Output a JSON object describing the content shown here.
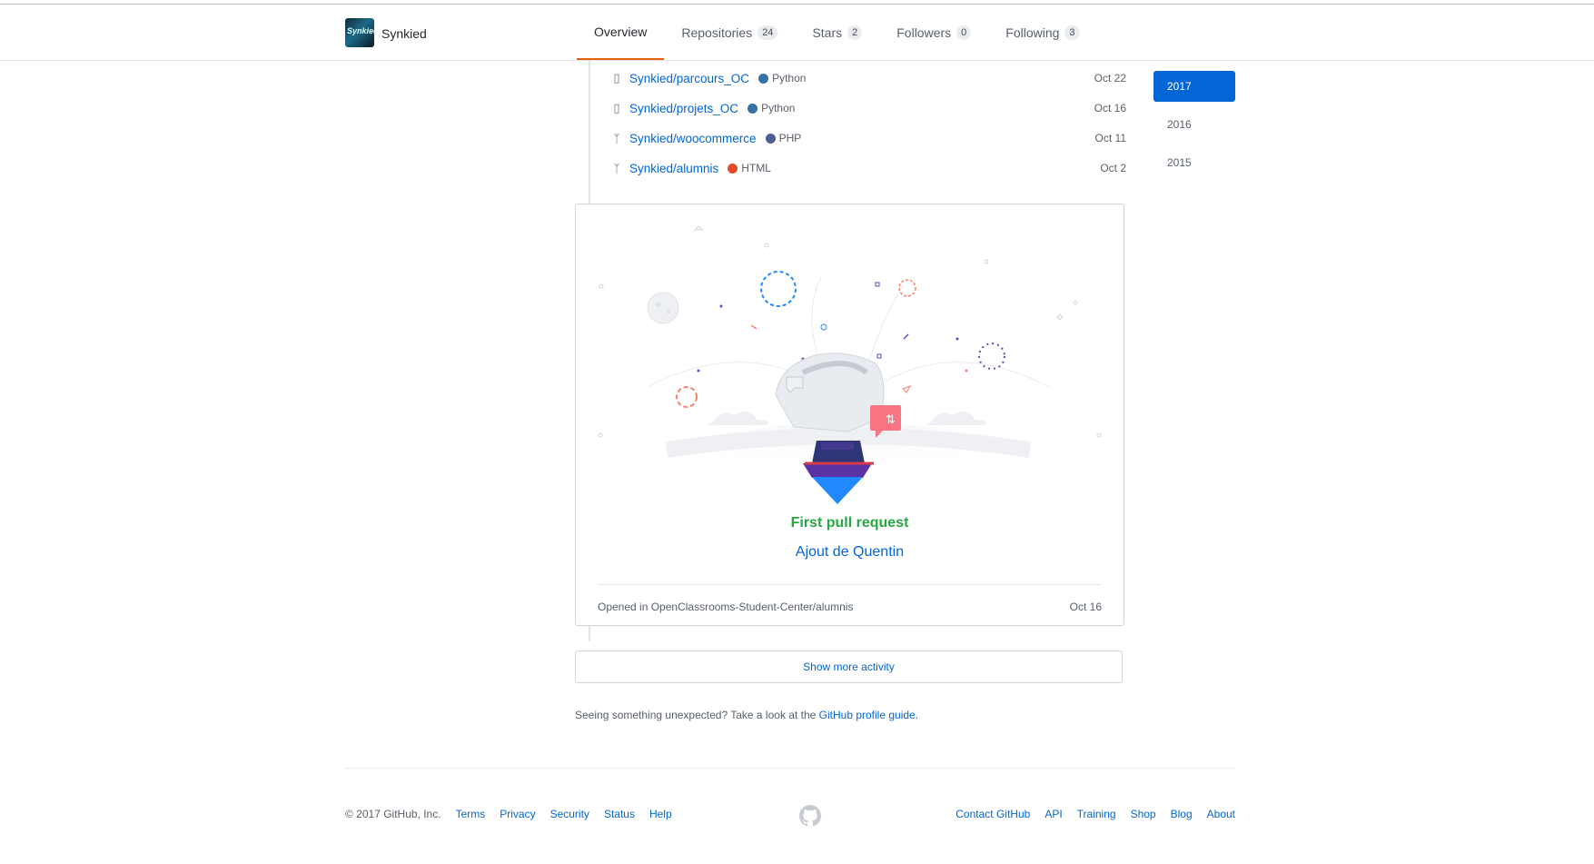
{
  "profile": {
    "username": "Synkied",
    "avatar_text": "Synkied"
  },
  "nav": {
    "tabs": [
      {
        "label": "Overview",
        "count": null
      },
      {
        "label": "Repositories",
        "count": "24"
      },
      {
        "label": "Stars",
        "count": "2"
      },
      {
        "label": "Followers",
        "count": "0"
      },
      {
        "label": "Following",
        "count": "3"
      }
    ]
  },
  "repos": [
    {
      "name": "Synkied/parcours_OC",
      "language": "Python",
      "color": "#3572A5",
      "date": "Oct 22",
      "icon": "repo-icon"
    },
    {
      "name": "Synkied/projets_OC",
      "language": "Python",
      "color": "#3572A5",
      "date": "Oct 16",
      "icon": "repo-icon"
    },
    {
      "name": "Synkied/woocommerce",
      "language": "PHP",
      "color": "#4F5D95",
      "date": "Oct 11",
      "icon": "fork-icon"
    },
    {
      "name": "Synkied/alumnis",
      "language": "HTML",
      "color": "#e34c26",
      "date": "Oct 2",
      "icon": "fork-icon"
    }
  ],
  "years": [
    "2017",
    "2016",
    "2015"
  ],
  "pull_request": {
    "title": "First pull request",
    "link": "Ajout de Quentin",
    "opened_in": "Opened in OpenClassrooms-Student-Center/alumnis",
    "date": "Oct 16"
  },
  "show_more": "Show more activity",
  "unexpected": {
    "text": "Seeing something unexpected? Take a look at the ",
    "link": "GitHub profile guide",
    "end": "."
  },
  "footer": {
    "copyright": "© 2017 GitHub, Inc.",
    "left_links": [
      "Terms",
      "Privacy",
      "Security",
      "Status",
      "Help"
    ],
    "right_links": [
      "Contact GitHub",
      "API",
      "Training",
      "Shop",
      "Blog",
      "About"
    ]
  },
  "colors": {
    "accent": "#0366d6",
    "tab_underline": "#e36209",
    "success": "#28a745"
  }
}
